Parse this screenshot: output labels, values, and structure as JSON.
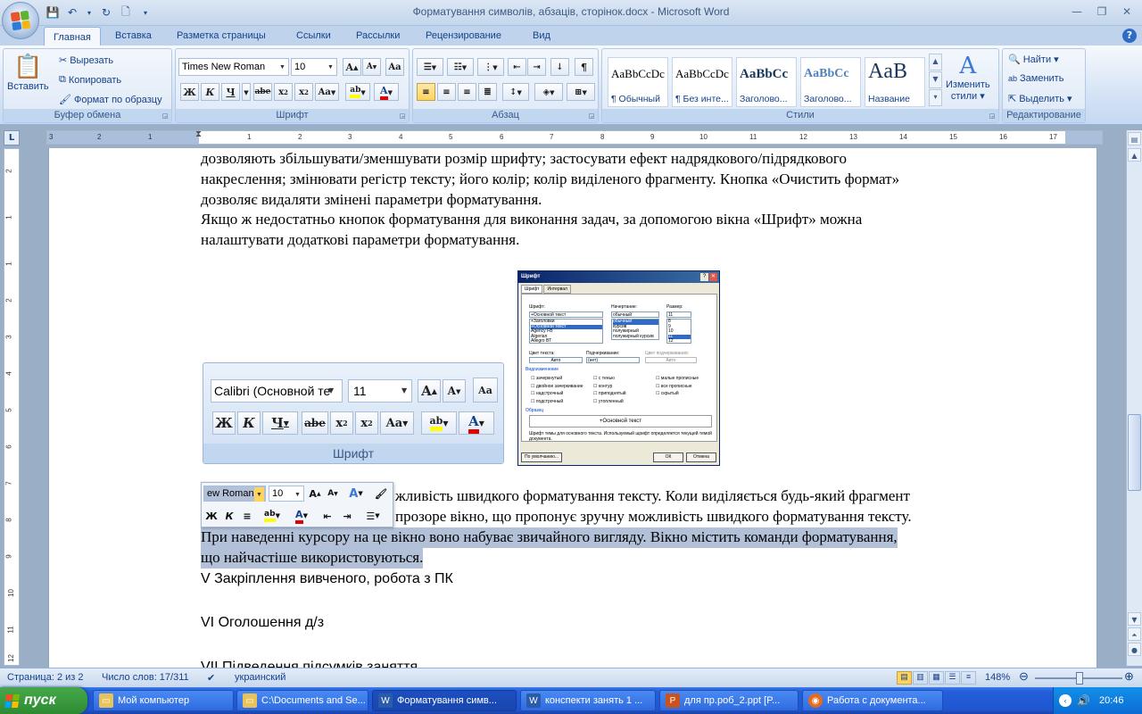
{
  "window": {
    "title": "Форматування символів, абзаців, сторінок.docx - Microsoft Word"
  },
  "qat": {
    "icons": [
      "save-icon",
      "undo-icon",
      "redo-icon",
      "new-document-icon"
    ]
  },
  "tabs": [
    "Главная",
    "Вставка",
    "Разметка страницы",
    "Ссылки",
    "Рассылки",
    "Рецензирование",
    "Вид"
  ],
  "clipboard": {
    "paste": "Вставить",
    "cut": "Вырезать",
    "copy": "Копировать",
    "format_painter": "Формат по образцу",
    "label": "Буфер обмена"
  },
  "font_group": {
    "font_name": "Times New Roman",
    "font_size": "10",
    "label": "Шрифт"
  },
  "paragraph_group": {
    "label": "Абзац"
  },
  "styles_group": {
    "label": "Стили",
    "items": [
      {
        "sample": "AaBbCcDc",
        "name": "¶ Обычный"
      },
      {
        "sample": "AaBbCcDc",
        "name": "¶ Без инте..."
      },
      {
        "sample": "AaBbCc",
        "name": "Заголово..."
      },
      {
        "sample": "AaBbCc",
        "name": "Заголово..."
      },
      {
        "sample": "AaB",
        "name": "Название"
      }
    ],
    "change_styles_1": "Изменить",
    "change_styles_2": "стили ▾"
  },
  "editing_group": {
    "find": "Найти ▾",
    "replace": "Заменить",
    "select": "Выделить ▾",
    "label": "Редактирование"
  },
  "ruler": {
    "h_ticks": [
      "3",
      "2",
      "1",
      "1",
      "2",
      "3",
      "4",
      "5",
      "6",
      "7",
      "8",
      "9",
      "10",
      "11",
      "12",
      "13",
      "14",
      "15",
      "16",
      "17"
    ],
    "v_ticks": [
      "2",
      "1",
      "1",
      "2",
      "3",
      "4",
      "5",
      "6",
      "7",
      "8",
      "9",
      "10",
      "11",
      "12"
    ]
  },
  "document": {
    "lines": [
      "дозволяють збільшувати/зменшувати розмір шрифту; застосувати ефект надрядкового/підрядкового",
      "накреслення; змінювати регістр тексту; його колір; колір виділеного фрагменту. Кнопка «Очистить формат»",
      "дозволяє видаляти змінені параметри форматування.",
      "Якщо ж недостатньо кнопок форматування для виконання задач, за допомогою вікна «Шрифт» можна",
      "налаштувати додаткові параметри форматування."
    ],
    "partial_line_1": "жливість швидкого форматування тексту. Коли виділяється будь-який фрагмент",
    "partial_line_2": "прозоре вікно, що пропонує зручну можливість швидкого форматування тексту.",
    "selected_line_1": "При наведенні курсору на це вікно воно набуває звичайного вигляду. Вікно містить команди форматування,",
    "selected_line_2": "що найчастіше використовуються.",
    "heading_5": "V Закріплення вивченого, робота з ПК",
    "heading_6": "VI Оголошення д/з",
    "heading_7": "VII Підведення підсумків заняття"
  },
  "font_group_image": {
    "font": "Calibri (Основной те",
    "size": "11",
    "label": "Шрифт"
  },
  "font_dialog_image": {
    "title": "Шрифт",
    "tab1": "Шрифт",
    "tab2": "Интервал",
    "font_label": "Шрифт:",
    "font_value": "+Основной текст",
    "font_list": [
      "+Заголовки",
      "+Основной текст",
      "Agency FB",
      "Algerian",
      "Allegro BT"
    ],
    "style_label": "Начертание:",
    "style_value": "обычный",
    "style_list": [
      "обычный",
      "курсив",
      "полужирный",
      "полужирный курсив"
    ],
    "size_label": "Размер:",
    "size_value": "11",
    "size_list": [
      "8",
      "9",
      "10",
      "11",
      "12"
    ],
    "color_label": "Цвет текста:",
    "color_value": "Авто",
    "underline_label": "Подчеркивание:",
    "underline_value": "(нет)",
    "underline_color_label": "Цвет подчеркивания:",
    "underline_color_value": "Авто",
    "effects_label": "Видоизменение",
    "effects": [
      "зачеркнутый",
      "двойное зачеркивание",
      "надстрочный",
      "подстрочный",
      "с тенью",
      "контур",
      "приподнятый",
      "утопленный",
      "малые прописные",
      "все прописные",
      "скрытый"
    ],
    "sample_label": "Образец",
    "sample_text": "+Основной текст",
    "note": "Шрифт темы для основного текста. Используемый шрифт определяется текущей темой документа.",
    "default_btn": "По умолчанию...",
    "ok_btn": "ОК",
    "cancel_btn": "Отмена"
  },
  "mini_toolbar": {
    "font": "ew Roman",
    "size": "10"
  },
  "status": {
    "page": "Страница: 2 из 2",
    "words": "Число слов: 17/311",
    "language": "украинский",
    "zoom": "148%"
  },
  "taskbar": {
    "start": "пуск",
    "items": [
      "Мой компьютер",
      "C:\\Documents and Se...",
      "Форматування симв...",
      "конспекти занять 1 ...",
      "для пр.роб_2.ppt [P...",
      "Работа с документа..."
    ],
    "lang": "UK",
    "clock": "20:46"
  },
  "colors": {
    "accent": "#15428b",
    "highlight_yellow": "#ffff00",
    "font_red": "#e00000",
    "selection": "#b3c1d8"
  }
}
